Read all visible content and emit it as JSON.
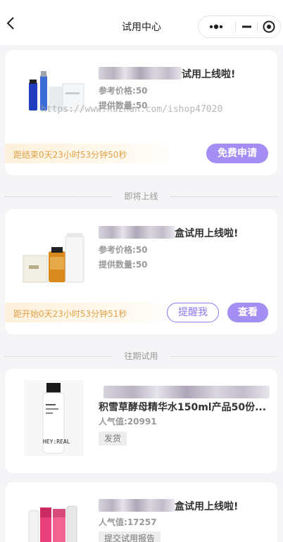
{
  "nav": {
    "title": "试用中心"
  },
  "watermark": "https://www.huzhan.com/ishop47020",
  "sections": {
    "upcoming": "即将上线",
    "past": "往期试用"
  },
  "cards": [
    {
      "title_visible": "试用上线啦!",
      "price_label": "参考价格:",
      "price_value": "50",
      "qty_label": "提供数量:",
      "qty_value": "50",
      "countdown": "距结束0天23小时53分钟50秒",
      "button": "免费申请"
    },
    {
      "title_visible": "盒试用上线啦!",
      "price_label": "参考价格:",
      "price_value": "50",
      "qty_label": "提供数量:",
      "qty_value": "50",
      "countdown": "距开始0天23小时53分钟51秒",
      "remind_button": "提醒我",
      "view_button": "查看"
    },
    {
      "title_visible": "积雪草酵母精华水150ml产品50份...",
      "pop_label": "人气值:",
      "pop_value": "20991",
      "tag": "发货",
      "bottle_brand": "HEY:REAL"
    },
    {
      "title_visible": "盒试用上线啦!",
      "pop_label": "人气值:",
      "pop_value": "17257",
      "tag": "提交试用报告"
    }
  ],
  "colors": {
    "accent": "#a48ef4",
    "countdown": "#e0a24a"
  }
}
